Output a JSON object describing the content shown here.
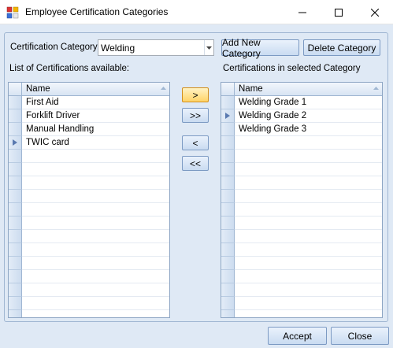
{
  "window": {
    "title": "Employee Certification Categories",
    "icon": "app-grid-icon",
    "controls": [
      "minimize-icon",
      "maximize-icon",
      "close-icon"
    ]
  },
  "category": {
    "label": "Certification Category",
    "selected": "Welding",
    "add_button": "Add New Category",
    "delete_button": "Delete Category"
  },
  "available": {
    "label": "List of Certifications available:",
    "column": "Name",
    "items": [
      "First Aid",
      "Forklift Driver",
      "Manual Handling",
      "TWIC card"
    ],
    "current_row": 3,
    "visible_rows": 17
  },
  "transfer": {
    "move_one": ">",
    "move_all": ">>",
    "remove_one": "<",
    "remove_all": "<<"
  },
  "selected": {
    "label": "Certifications in selected Category",
    "column": "Name",
    "items": [
      "Welding Grade 1",
      "Welding Grade 2",
      "Welding Grade 3"
    ],
    "current_row": 1,
    "visible_rows": 17
  },
  "footer": {
    "accept": "Accept",
    "close": "Close"
  },
  "colors": {
    "background": "#dfe9f5",
    "focus_button": "#ffd467",
    "grid_border": "#8ea6c4"
  }
}
